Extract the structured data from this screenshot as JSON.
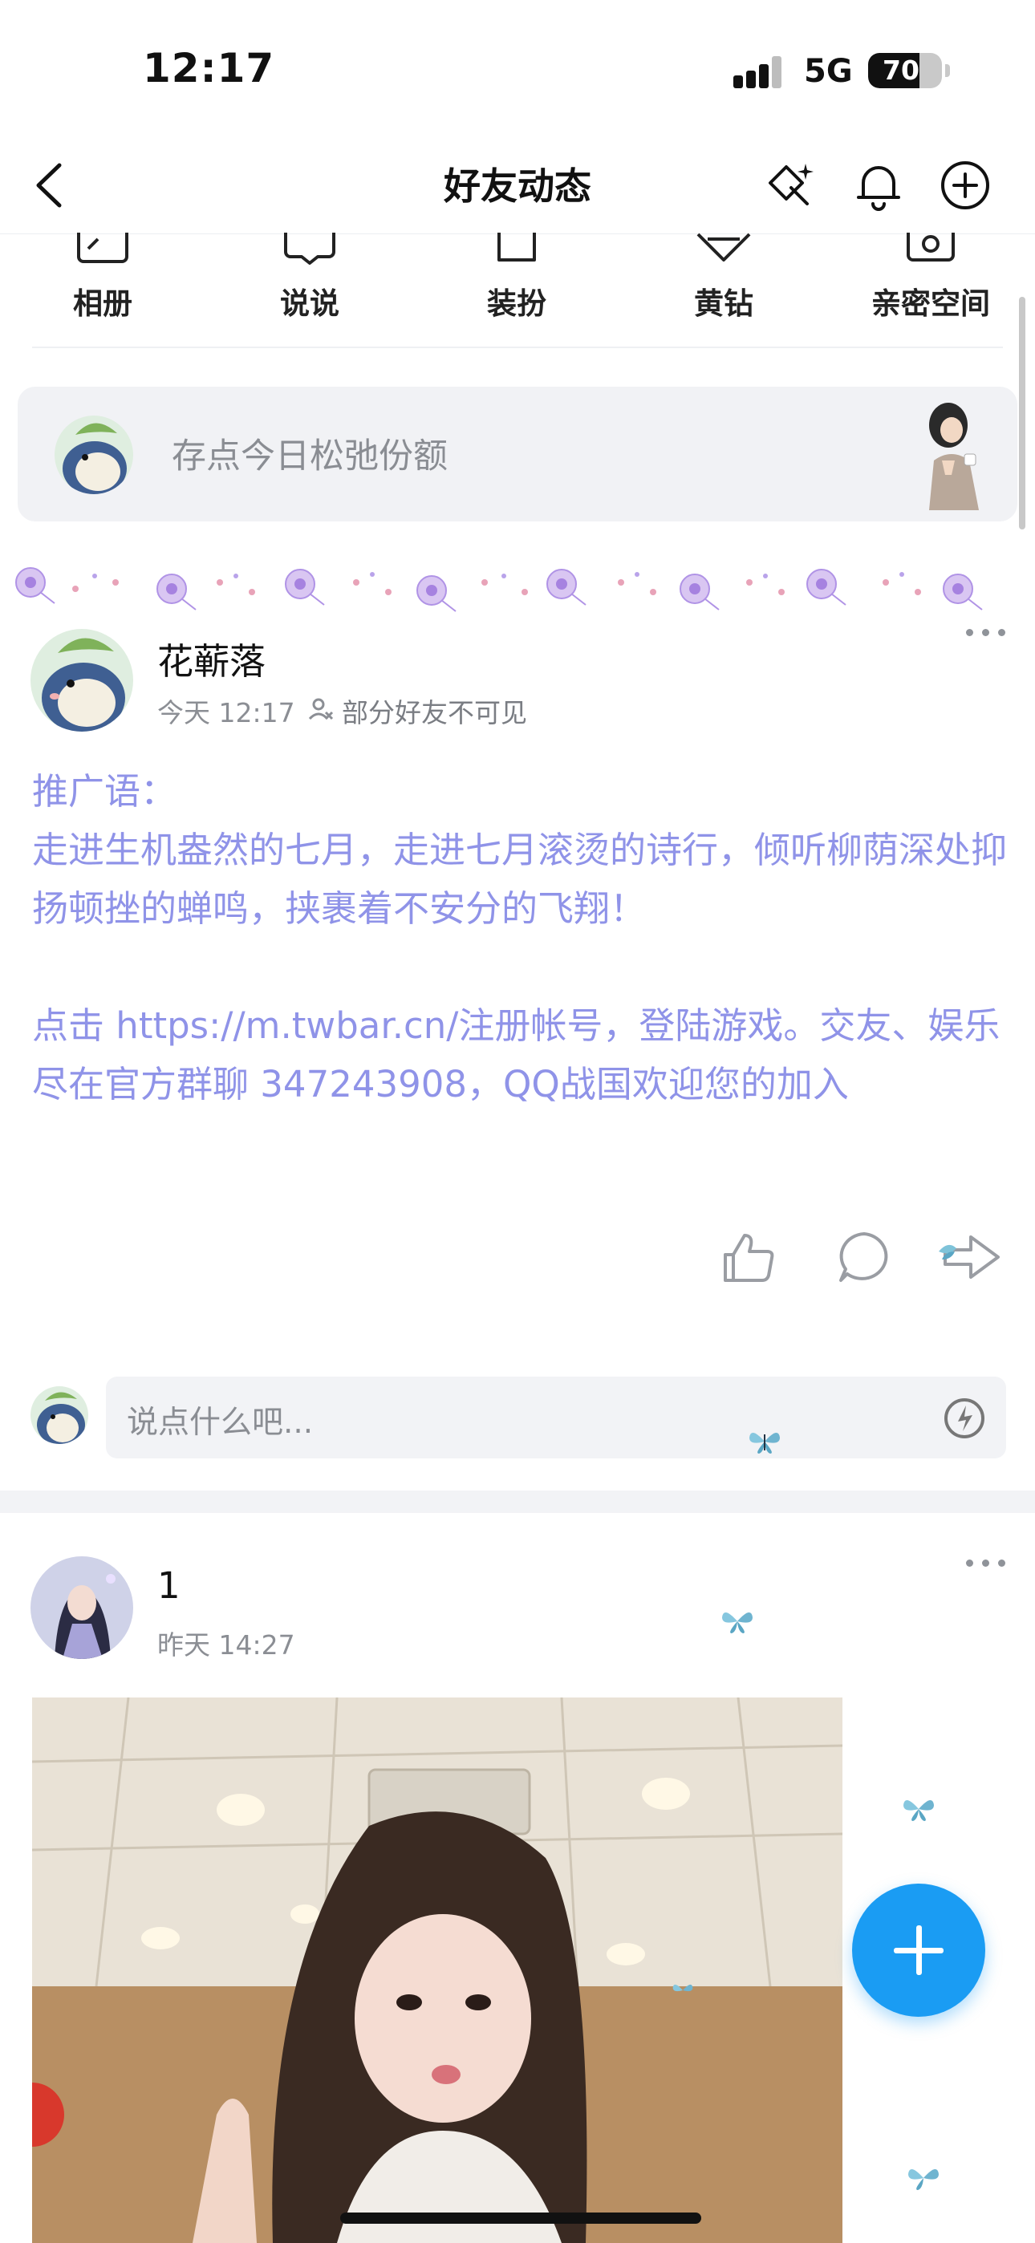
{
  "status_bar": {
    "time": "12:17",
    "network": "5G",
    "battery": "70",
    "battery_level": 0.7
  },
  "nav": {
    "title": "好友动态",
    "back_icon": "chevron-left-icon",
    "icons": [
      "sparkle-diamond-icon",
      "bell-icon",
      "plus-circle-icon"
    ]
  },
  "quick_menu": [
    {
      "label": "相册",
      "icon": "photo-album-icon"
    },
    {
      "label": "说说",
      "icon": "chat-bubble-icon"
    },
    {
      "label": "装扮",
      "icon": "shirt-icon"
    },
    {
      "label": "黄钻",
      "icon": "diamond-icon"
    },
    {
      "label": "亲密空间",
      "icon": "couple-space-icon"
    }
  ],
  "mood": {
    "placeholder": "存点今日松弛份额"
  },
  "post1": {
    "name": "花蕲落",
    "time": "今天 12:17",
    "privacy": "部分好友不可见",
    "content": "推广语：\n走进生机盎然的七月，走进七月滚烫的诗行，倾听柳荫深处抑扬顿挫的蝉鸣，挟裹着不安分的飞翔！\n\n点击 https://m.twbar.cn/注册帐号，登陆游戏。交友、娱乐尽在官方群聊 347243908，QQ战国欢迎您的加入"
  },
  "comment": {
    "placeholder": "说点什么吧..."
  },
  "post2": {
    "name": "1",
    "time": "昨天 14:27"
  },
  "colors": {
    "link_text": "#8f93e8",
    "fab": "#1a9cf3",
    "muted": "#8b8e94"
  }
}
